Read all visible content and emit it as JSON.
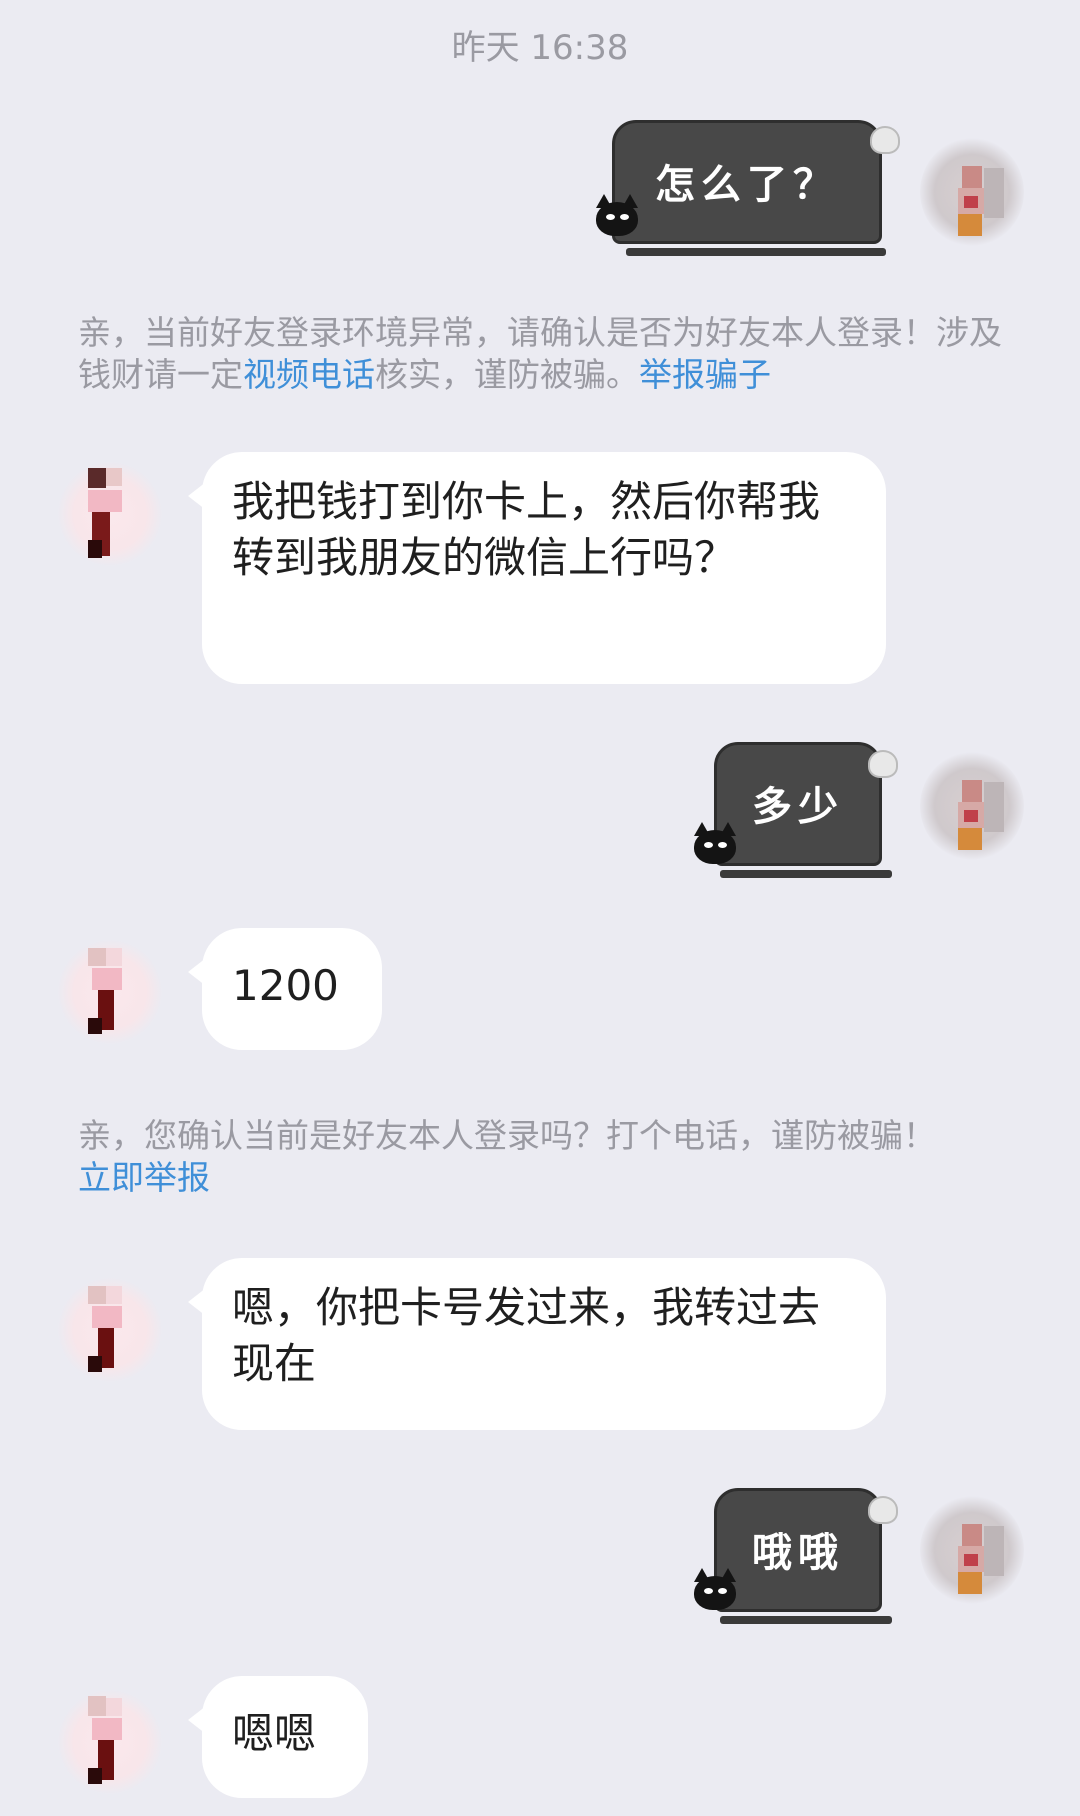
{
  "chat": {
    "timestamp": "昨天 16:38",
    "messages": [
      {
        "side": "right",
        "type": "sticker",
        "text": "怎么了？"
      },
      {
        "side": "system",
        "segments": [
          {
            "text": "亲，当前好友登录环境异常，请确认是否为好友本人登录！涉及钱财请一定",
            "link": false
          },
          {
            "text": "视频电话",
            "link": true
          },
          {
            "text": "核实，谨防被骗。",
            "link": false
          },
          {
            "text": "举报骗子",
            "link": true
          }
        ]
      },
      {
        "side": "left",
        "type": "text",
        "text": "我把钱打到你卡上，然后你帮我转到我朋友的微信上行吗？"
      },
      {
        "side": "right",
        "type": "sticker",
        "text": "多少"
      },
      {
        "side": "left",
        "type": "text",
        "text": "1200"
      },
      {
        "side": "system",
        "segments": [
          {
            "text": "亲，您确认当前是好友本人登录吗？打个电话，谨防被骗！",
            "link": false
          },
          {
            "text": "立即举报",
            "link": true
          }
        ]
      },
      {
        "side": "left",
        "type": "text",
        "text": "嗯，你把卡号发过来，我转过去现在"
      },
      {
        "side": "right",
        "type": "sticker",
        "text": "哦哦"
      },
      {
        "side": "left",
        "type": "text",
        "text": "嗯嗯"
      }
    ]
  },
  "colors": {
    "background": "#ebebf2",
    "bubble": "#ffffff",
    "system_text": "#9a9aa2",
    "link": "#3f8fd8",
    "sticker_board": "#484848"
  },
  "icons": {
    "sticker_mascot": "black-cat-icon",
    "sticker_decoration": "ghost-icon"
  }
}
